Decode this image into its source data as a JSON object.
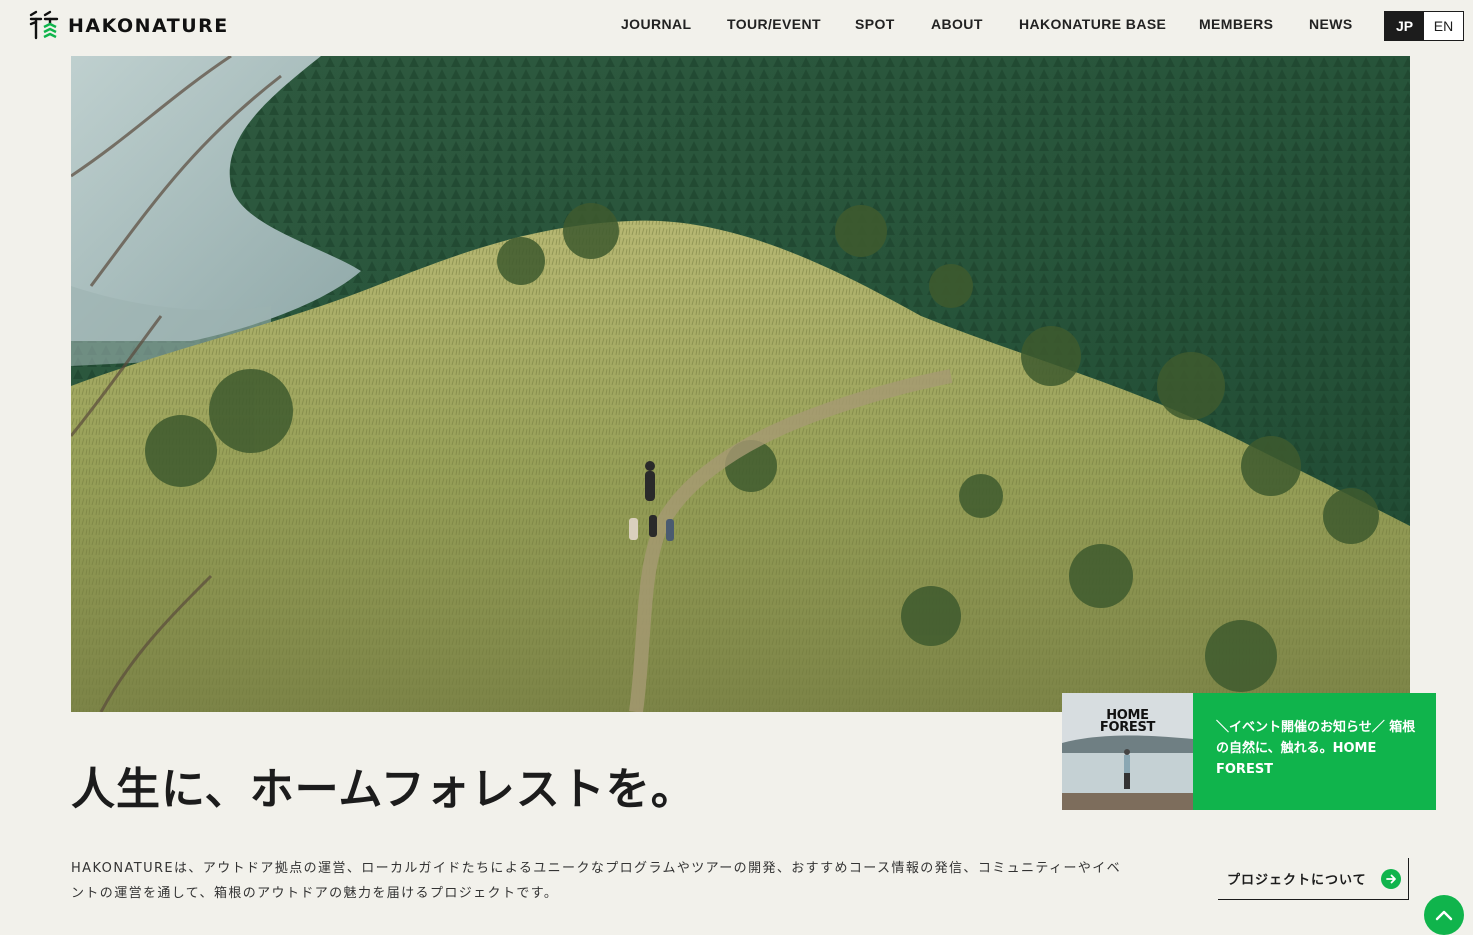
{
  "header": {
    "logo_text": "HAKONATURE",
    "nav": [
      {
        "label": "JOURNAL"
      },
      {
        "label": "TOUR/EVENT"
      },
      {
        "label": "SPOT"
      },
      {
        "label": "ABOUT"
      },
      {
        "label": "HAKONATURE BASE"
      },
      {
        "label": "MEMBERS"
      },
      {
        "label": "NEWS"
      }
    ],
    "lang": {
      "active": "JP",
      "other": "EN"
    }
  },
  "event_card": {
    "thumb_title_line1": "HOME",
    "thumb_title_line2": "FOREST",
    "text": "＼イベント開催のお知らせ／ 箱根の自然に、触れる。HOME FOREST"
  },
  "tagline": "人生に、ホームフォレストを。",
  "description": "HAKONATUREは、アウトドア拠点の運営、ローカルガイドたちによるユニークなプログラムやツアーの開発、おすすめコース情報の発信、コミュニティーやイベントの運営を通して、箱根のアウトドアの魅力を届けるプロジェクトです。",
  "project_link": {
    "label": "プロジェクトについて"
  },
  "icons": {
    "logo": "hakonature-logo-icon",
    "arrow": "arrow-right-icon",
    "back_to_top": "chevron-up-icon"
  },
  "colors": {
    "accent": "#10b44c",
    "background": "#f2f1eb",
    "text": "#1c1c1c"
  }
}
